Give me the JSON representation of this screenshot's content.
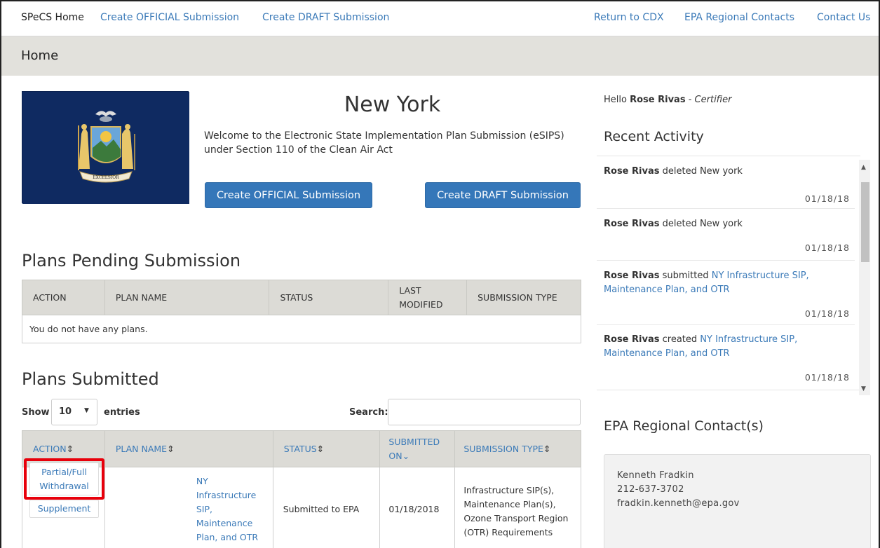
{
  "topnav": {
    "home": "SPeCS Home",
    "create_official": "Create OFFICIAL Submission",
    "create_draft": "Create DRAFT Submission",
    "return_cdx": "Return to CDX",
    "regional_contacts": "EPA Regional Contacts",
    "contact_us": "Contact Us"
  },
  "header": {
    "title": "Home"
  },
  "state": {
    "name": "New York",
    "welcome": "Welcome to the Electronic State Implementation Plan Submission (eSIPS) under Section 110 of the Clean Air Act",
    "flag_motto": "EXCELSIOR",
    "official_button": "Create OFFICIAL Submission",
    "draft_button": "Create DRAFT Submission"
  },
  "pending": {
    "title": "Plans Pending Submission",
    "columns": [
      "ACTION",
      "PLAN NAME",
      "STATUS",
      "LAST MODIFIED",
      "SUBMISSION TYPE"
    ],
    "empty_message": "You do not have any plans."
  },
  "submitted": {
    "title": "Plans Submitted",
    "show_label": "Show",
    "entries_value": "10",
    "entries_label": "entries",
    "search_label": "Search:",
    "columns": [
      "ACTION",
      "PLAN NAME",
      "STATUS",
      "SUBMITTED ON",
      "SUBMISSION TYPE"
    ],
    "rows": [
      {
        "action_withdrawal": "Partial/Full Withdrawal",
        "action_supplement": "Supplement",
        "plan_name": "NY Infrastructure SIP, Maintenance Plan, and OTR",
        "status": "Submitted to EPA",
        "submitted_on": "01/18/2018",
        "submission_type": "Infrastructure SIP(s), Maintenance Plan(s), Ozone Transport Region (OTR) Requirements"
      }
    ]
  },
  "user": {
    "greeting": "Hello",
    "name": "Rose Rivas",
    "role_sep": " - ",
    "role": "Certifier"
  },
  "recent": {
    "title": "Recent Activity",
    "items": [
      {
        "user": "Rose Rivas",
        "action": " deleted New york",
        "link": "",
        "date": "01/18/18"
      },
      {
        "user": "Rose Rivas",
        "action": " deleted New york",
        "link": "",
        "date": "01/18/18"
      },
      {
        "user": "Rose Rivas",
        "action": " submitted ",
        "link": "NY Infrastructure SIP, Maintenance Plan, and OTR",
        "date": "01/18/18"
      },
      {
        "user": "Rose Rivas",
        "action": " created ",
        "link": "NY Infrastructure SIP, Maintenance Plan, and OTR",
        "date": "01/18/18"
      }
    ]
  },
  "contacts": {
    "title": "EPA Regional Contact(s)",
    "name": "Kenneth Fradkin",
    "phone": "212-637-3702",
    "email": "fradkin.kenneth@epa.gov"
  },
  "colors": {
    "link": "#3b7ab8",
    "button": "#3577b9",
    "header_bar": "#e2e1dc",
    "highlight": "#e8000b",
    "flag": "#0f2a61"
  }
}
